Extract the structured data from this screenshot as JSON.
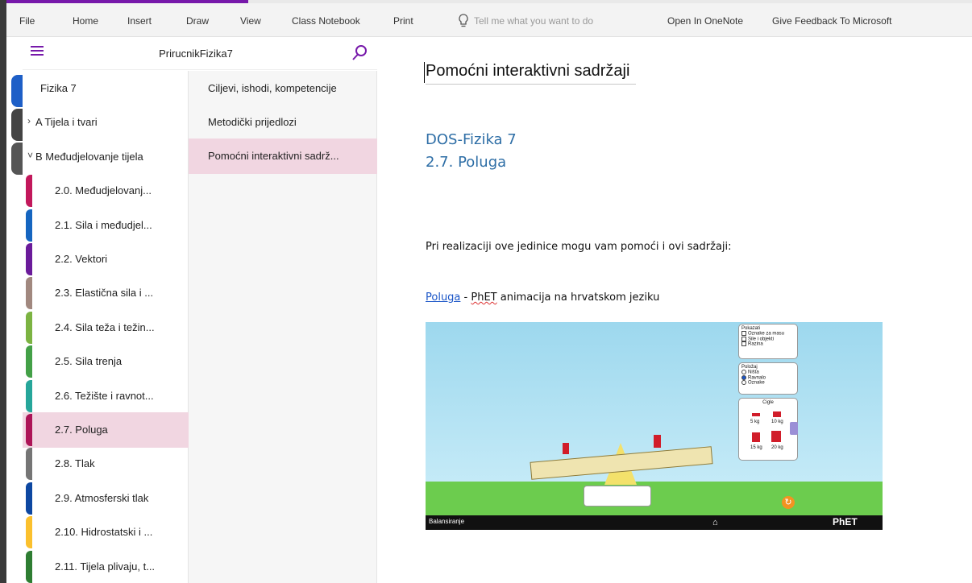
{
  "ribbon": {
    "tabs": [
      "File",
      "Home",
      "Insert",
      "Draw",
      "View",
      "Class Notebook",
      "Print"
    ],
    "tell_me": "Tell me what you want to do",
    "open_in_onenote": "Open In OneNote",
    "feedback": "Give Feedback To Microsoft"
  },
  "notebook": {
    "title": "PrirucnikFizika7"
  },
  "sections": [
    {
      "label": "Fizika 7",
      "chevron": "",
      "indent": 0,
      "color": ""
    },
    {
      "label": "A Tijela i tvari",
      "chevron": ">",
      "indent": 0,
      "color": ""
    },
    {
      "label": "B Međudjelovanje tijela",
      "chevron": "v",
      "indent": 0,
      "color": ""
    },
    {
      "label": "2.0. Međudjelovanj...",
      "chevron": "",
      "indent": 1,
      "color": "#c2185b"
    },
    {
      "label": "2.1. Sila i međudjel...",
      "chevron": "",
      "indent": 1,
      "color": "#1565c0"
    },
    {
      "label": "2.2. Vektori",
      "chevron": "",
      "indent": 1,
      "color": "#6a1b9a"
    },
    {
      "label": "2.3. Elastična sila i ...",
      "chevron": "",
      "indent": 1,
      "color": "#a1887f"
    },
    {
      "label": "2.4. Sila teža i težin...",
      "chevron": "",
      "indent": 1,
      "color": "#7cb342"
    },
    {
      "label": "2.5. Sila trenja",
      "chevron": "",
      "indent": 1,
      "color": "#43a047"
    },
    {
      "label": "2.6. Težište i ravnot...",
      "chevron": "",
      "indent": 1,
      "color": "#26a69a"
    },
    {
      "label": "2.7. Poluga",
      "chevron": "",
      "indent": 1,
      "color": "#ad1457",
      "selected": true
    },
    {
      "label": "2.8. Tlak",
      "chevron": "",
      "indent": 1,
      "color": "#757575"
    },
    {
      "label": "2.9. Atmosferski tlak",
      "chevron": "",
      "indent": 1,
      "color": "#0d47a1"
    },
    {
      "label": "2.10. Hidrostatski i ...",
      "chevron": "",
      "indent": 1,
      "color": "#fbc02d"
    },
    {
      "label": "2.11. Tijela plivaju, t...",
      "chevron": "",
      "indent": 1,
      "color": "#2e7d32"
    }
  ],
  "pages": [
    {
      "label": "Ciljevi, ishodi, kompetencije"
    },
    {
      "label": "Metodički prijedlozi"
    },
    {
      "label": "Pomoćni interaktivni sadrž...",
      "selected": true
    }
  ],
  "page": {
    "title": "Pomoćni interaktivni sadržaji",
    "heading1": "DOS-Fizika 7",
    "heading2": "2.7. Poluga",
    "paragraph": "Pri realizaciji ove jedinice mogu vam pomoći i ovi sadržaji:",
    "link_text": "Poluga",
    "link_sep": " - ",
    "link_phet": "PhET",
    "link_rest": " animacija na hrvatskom jeziku"
  },
  "sim": {
    "bottom_label": "Balansiranje",
    "panel_show_title": "Pokazati",
    "panel_show_items": [
      "Oznake za masu",
      "Sile i objekti",
      "Razina"
    ],
    "panel_pos_title": "Položaj",
    "panel_pos_items": [
      "Ništa",
      "Ravnalo",
      "Oznake"
    ],
    "panel_bricks_title": "Cigle",
    "brick_labels": [
      "5 kg",
      "10 kg",
      "15 kg",
      "20 kg"
    ],
    "logo": "PhET"
  },
  "colors": {
    "accent": "#7719aa",
    "selection": "#f1d6e1",
    "heading": "#2e6ea6",
    "link": "#1a55c7"
  }
}
